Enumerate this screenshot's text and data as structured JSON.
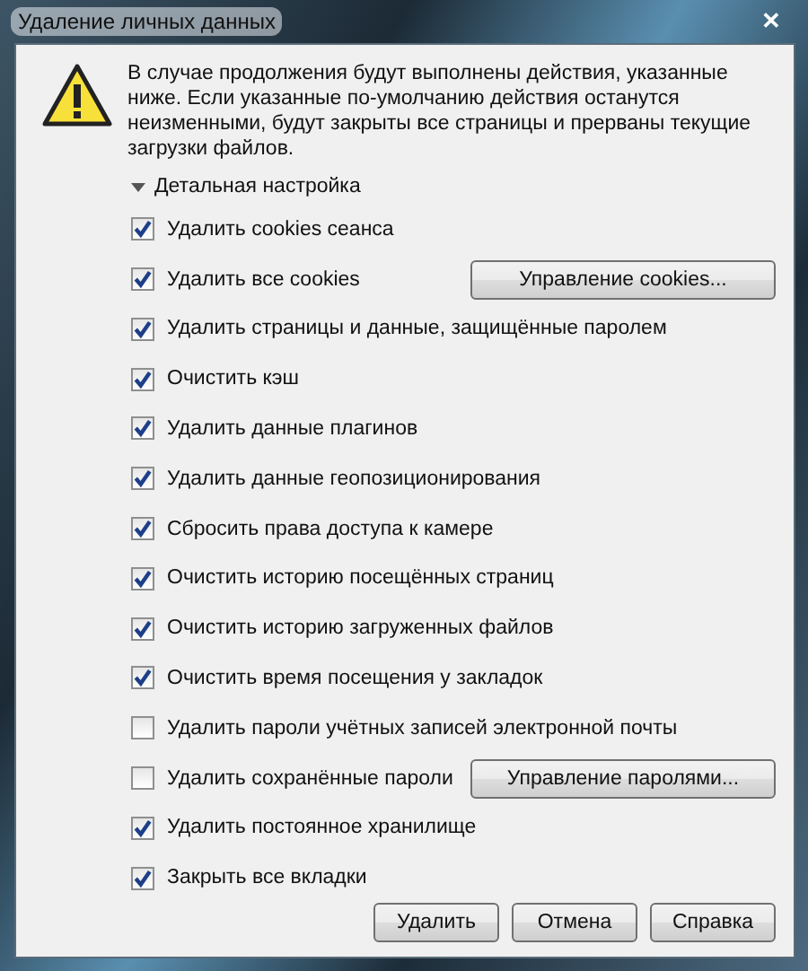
{
  "window": {
    "title": "Удаление личных данных",
    "close": "✕"
  },
  "message": "В случае продолжения будут выполнены действия, указанные ниже. Если указанные по-умолчанию действия останутся неизменными, будут закрыты все страницы и прерваны текущие загрузки файлов.",
  "details": {
    "label": "Детальная настройка",
    "expanded": true
  },
  "options": [
    {
      "label": "Удалить cookies сеанса",
      "checked": true
    },
    {
      "label": "Удалить все cookies",
      "checked": true,
      "button": "Управление cookies..."
    },
    {
      "label": "Удалить страницы и данные, защищённые паролем",
      "checked": true
    },
    {
      "label": "Очистить кэш",
      "checked": true
    },
    {
      "label": "Удалить данные плагинов",
      "checked": true
    },
    {
      "label": "Удалить данные геопозиционирования",
      "checked": true
    },
    {
      "label": "Сбросить права доступа к камере",
      "checked": true
    },
    {
      "label": "Очистить историю посещённых страниц",
      "checked": true
    },
    {
      "label": "Очистить историю загруженных файлов",
      "checked": true
    },
    {
      "label": "Очистить время посещения у закладок",
      "checked": true
    },
    {
      "label": "Удалить пароли учётных записей электронной почты",
      "checked": false
    },
    {
      "label": "Удалить сохранённые пароли",
      "checked": false,
      "button": "Управление паролями..."
    },
    {
      "label": "Удалить постоянное хранилище",
      "checked": true
    },
    {
      "label": "Закрыть все вкладки",
      "checked": true
    }
  ],
  "buttons": [
    "Удалить",
    "Отмена",
    "Справка"
  ]
}
